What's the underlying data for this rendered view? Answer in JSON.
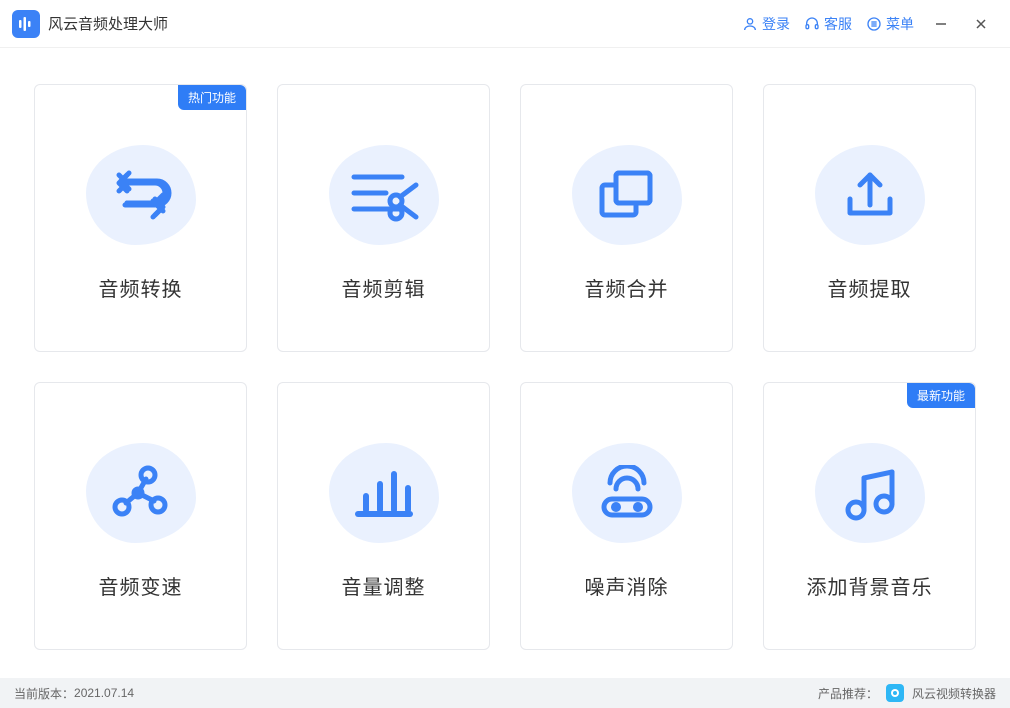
{
  "header": {
    "app_title": "风云音频处理大师",
    "login_label": "登录",
    "support_label": "客服",
    "menu_label": "菜单"
  },
  "cards": [
    {
      "label": "音频转换",
      "badge": "热门功能"
    },
    {
      "label": "音频剪辑",
      "badge": null
    },
    {
      "label": "音频合并",
      "badge": null
    },
    {
      "label": "音频提取",
      "badge": null
    },
    {
      "label": "音频变速",
      "badge": null
    },
    {
      "label": "音量调整",
      "badge": null
    },
    {
      "label": "噪声消除",
      "badge": null
    },
    {
      "label": "添加背景音乐",
      "badge": "最新功能"
    }
  ],
  "footer": {
    "version_prefix": "当前版本：",
    "version": "2021.07.14",
    "recommend_prefix": "产品推荐：",
    "recommend_app": "风云视频转换器"
  },
  "colors": {
    "primary": "#3b82f6",
    "blob": "#eaf1fe"
  }
}
